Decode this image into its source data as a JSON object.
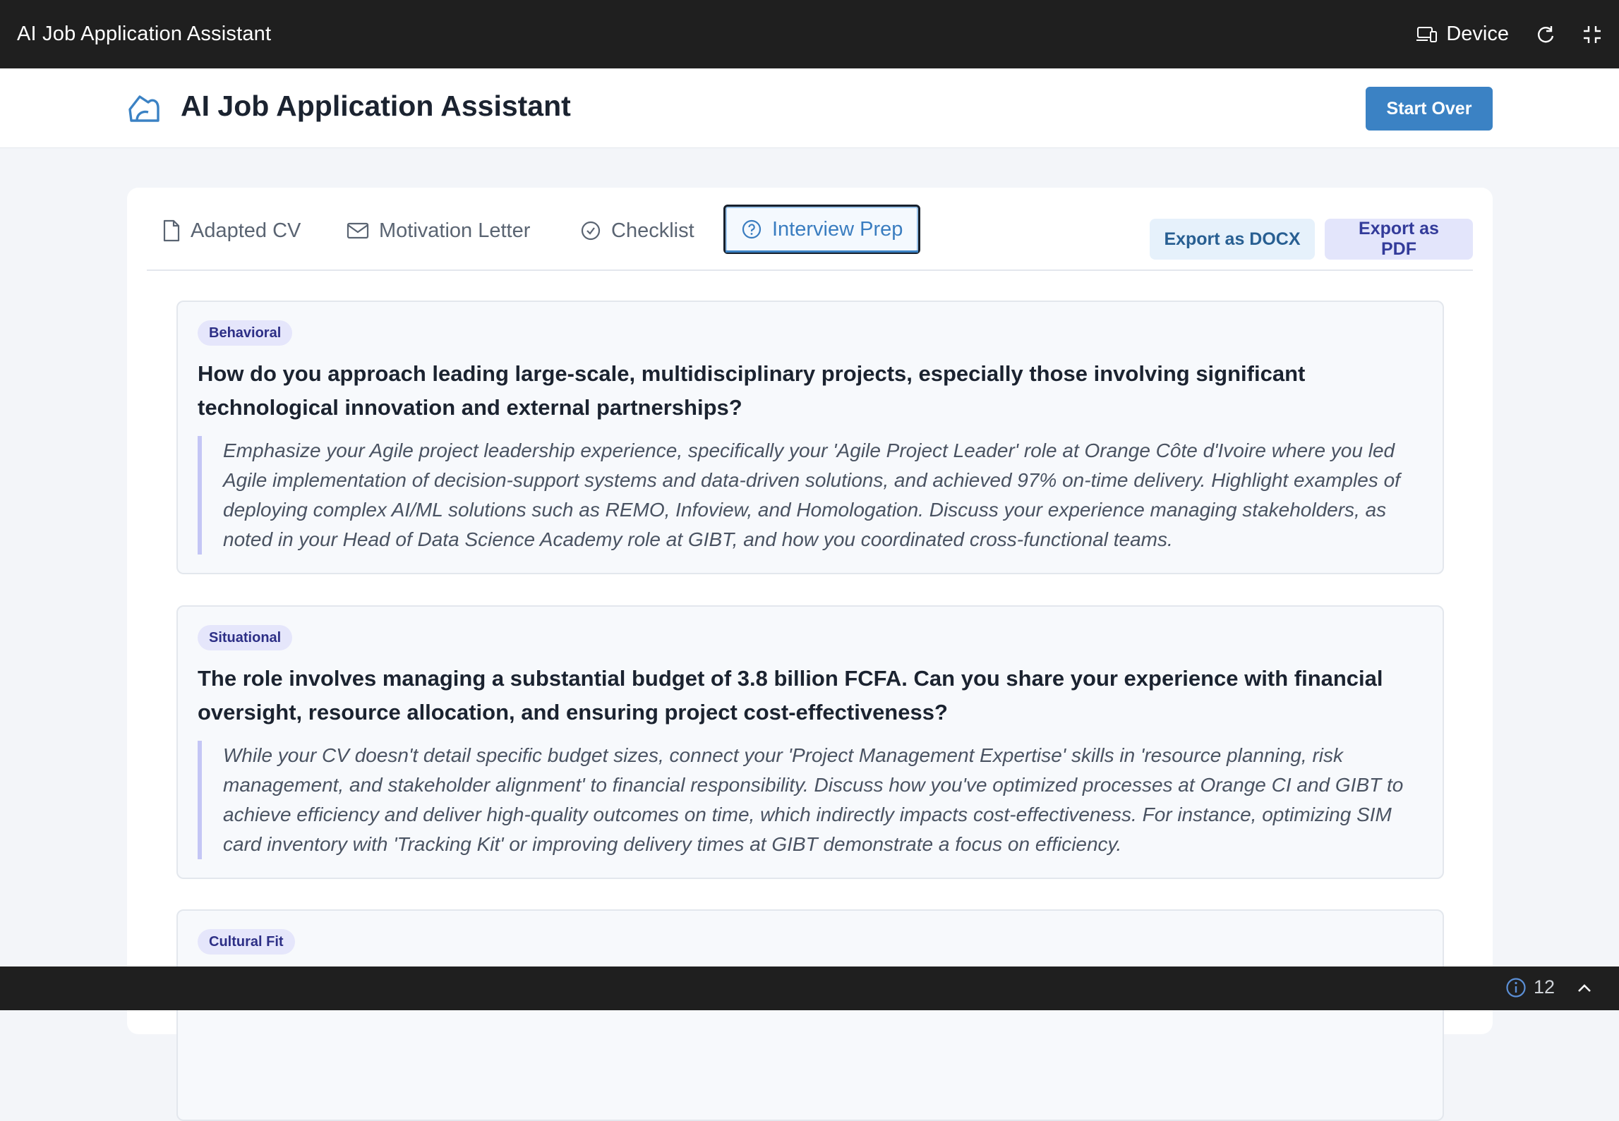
{
  "host": {
    "window_title": "AI Job Application Assistant",
    "device_label": "Device"
  },
  "header": {
    "title": "AI Job Application Assistant",
    "start_over_label": "Start Over"
  },
  "tabs": [
    {
      "label": "Adapted CV",
      "icon": "document-icon"
    },
    {
      "label": "Motivation Letter",
      "icon": "envelope-icon"
    },
    {
      "label": "Checklist",
      "icon": "check-circle-icon"
    },
    {
      "label": "Interview Prep",
      "icon": "question-circle-icon",
      "active": true
    }
  ],
  "export": {
    "docx_label": "Export as DOCX",
    "pdf_label": "Export as PDF"
  },
  "questions": [
    {
      "category": "Behavioral",
      "question": "How do you approach leading large-scale, multidisciplinary projects, especially those involving significant technological innovation and external partnerships?",
      "answer": "Emphasize your Agile project leadership experience, specifically your 'Agile Project Leader' role at Orange Côte d'Ivoire where you led Agile implementation of decision-support systems and data-driven solutions, and achieved 97% on-time delivery. Highlight examples of deploying complex AI/ML solutions such as REMO, Infoview, and Homologation. Discuss your experience managing stakeholders, as noted in your Head of Data Science Academy role at GIBT, and how you coordinated cross-functional teams."
    },
    {
      "category": "Situational",
      "question": "The role involves managing a substantial budget of 3.8 billion FCFA. Can you share your experience with financial oversight, resource allocation, and ensuring project cost-effectiveness?",
      "answer": "While your CV doesn't detail specific budget sizes, connect your 'Project Management Expertise' skills in 'resource planning, risk management, and stakeholder alignment' to financial responsibility. Discuss how you've optimized processes at Orange CI and GIBT to achieve efficiency and deliver high-quality outcomes on time, which indirectly impacts cost-effectiveness. For instance, optimizing SIM card inventory with 'Tracking Kit' or improving delivery times at GIBT demonstrate a focus on efficiency."
    },
    {
      "category": "Cultural Fit",
      "question": "",
      "answer": ""
    }
  ],
  "status": {
    "info_count": "12"
  }
}
